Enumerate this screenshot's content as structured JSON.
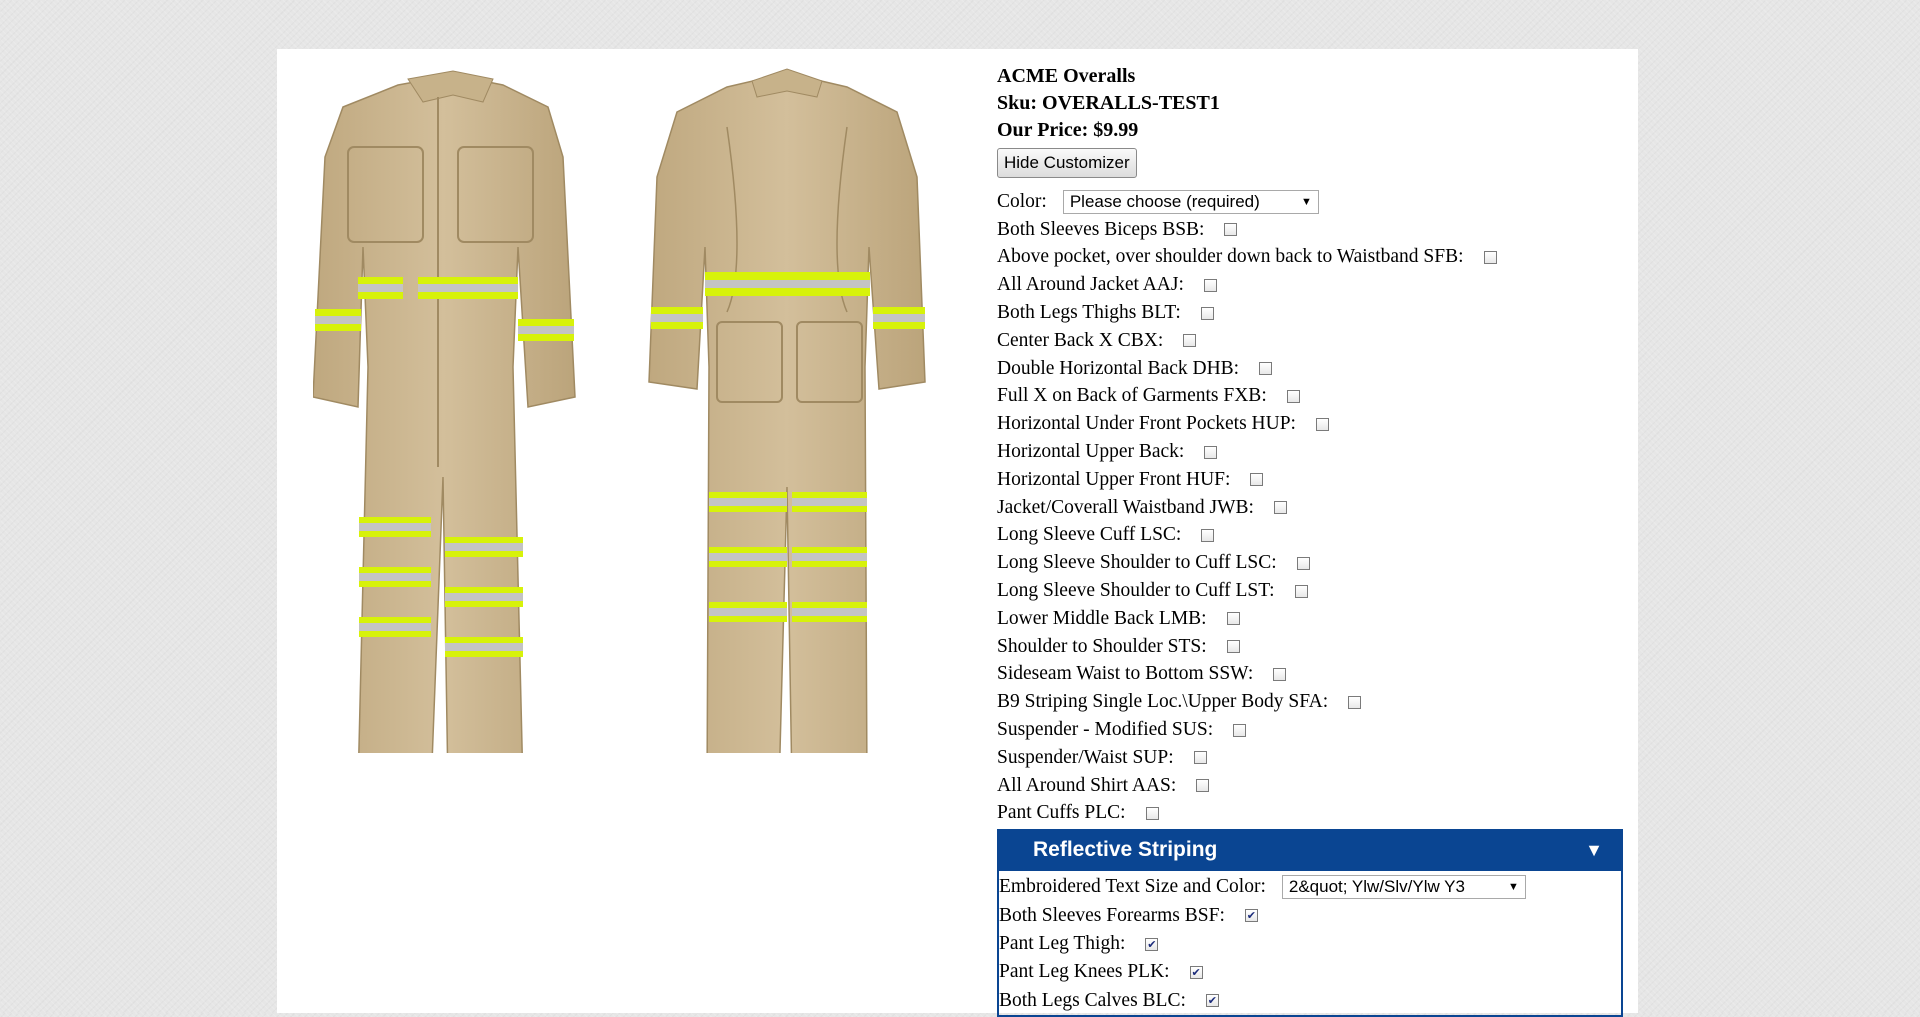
{
  "product": {
    "name": "ACME Overalls",
    "sku_line": "Sku: OVERALLS-TEST1",
    "price_line": "Our Price: $9.99",
    "hide_customizer_label": "Hide Customizer"
  },
  "color": {
    "label": "Color:",
    "selected": "Please choose (required)"
  },
  "options": [
    {
      "label": "Both Sleeves Biceps BSB:",
      "checked": false
    },
    {
      "label": "Above pocket, over shoulder down back to Waistband SFB:",
      "checked": false
    },
    {
      "label": "All Around Jacket AAJ:",
      "checked": false
    },
    {
      "label": "Both Legs Thighs BLT:",
      "checked": false
    },
    {
      "label": "Center Back X CBX:",
      "checked": false
    },
    {
      "label": "Double Horizontal Back DHB:",
      "checked": false
    },
    {
      "label": "Full X on Back of Garments FXB:",
      "checked": false
    },
    {
      "label": "Horizontal Under Front Pockets HUP:",
      "checked": false
    },
    {
      "label": "Horizontal Upper Back:",
      "checked": false
    },
    {
      "label": "Horizontal Upper Front HUF:",
      "checked": false
    },
    {
      "label": "Jacket/Coverall Waistband JWB:",
      "checked": false
    },
    {
      "label": "Long Sleeve Cuff LSC:",
      "checked": false
    },
    {
      "label": "Long Sleeve Shoulder to Cuff LSC:",
      "checked": false
    },
    {
      "label": "Long Sleeve Shoulder to Cuff LST:",
      "checked": false
    },
    {
      "label": "Lower Middle Back LMB:",
      "checked": false
    },
    {
      "label": "Shoulder to Shoulder STS:",
      "checked": false
    },
    {
      "label": "Sideseam Waist to Bottom SSW:",
      "checked": false
    },
    {
      "label": "B9 Striping Single Loc.\\Upper Body SFA:",
      "checked": false
    },
    {
      "label": "Suspender - Modified SUS:",
      "checked": false
    },
    {
      "label": "Suspender/Waist SUP:",
      "checked": false
    },
    {
      "label": "All Around Shirt AAS:",
      "checked": false
    },
    {
      "label": "Pant Cuffs PLC:",
      "checked": false
    }
  ],
  "reflective": {
    "title": "Reflective Striping",
    "toggle_icon": "triangle-down-icon",
    "embroidered_label": "Embroidered Text Size and Color:",
    "embroidered_selected": "2&quot; Ylw/Slv/Ylw Y3",
    "options": [
      {
        "label": "Both Sleeves Forearms BSF:",
        "checked": true
      },
      {
        "label": "Pant Leg Thigh:",
        "checked": true
      },
      {
        "label": "Pant Leg Knees PLK:",
        "checked": true
      },
      {
        "label": "Both Legs Calves BLC:",
        "checked": true
      }
    ]
  },
  "colors": {
    "panel": "#ffffff",
    "background": "#e6e6e6",
    "accent": "#0a4592",
    "garment": "#c9b48f",
    "reflective_yellow": "#d7f20a",
    "reflective_silver": "#c4c4c4"
  }
}
